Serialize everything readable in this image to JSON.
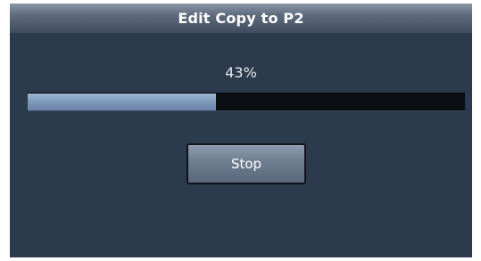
{
  "dialog": {
    "title": "Edit Copy to P2",
    "progress": {
      "percent_label": "43%",
      "value": 0.43
    },
    "stop_button": {
      "label": "Stop"
    }
  },
  "colors": {
    "dialog_background": "#2c3a4d",
    "progress_fill": "#7f9abb",
    "progress_track": "#0b0f14"
  }
}
